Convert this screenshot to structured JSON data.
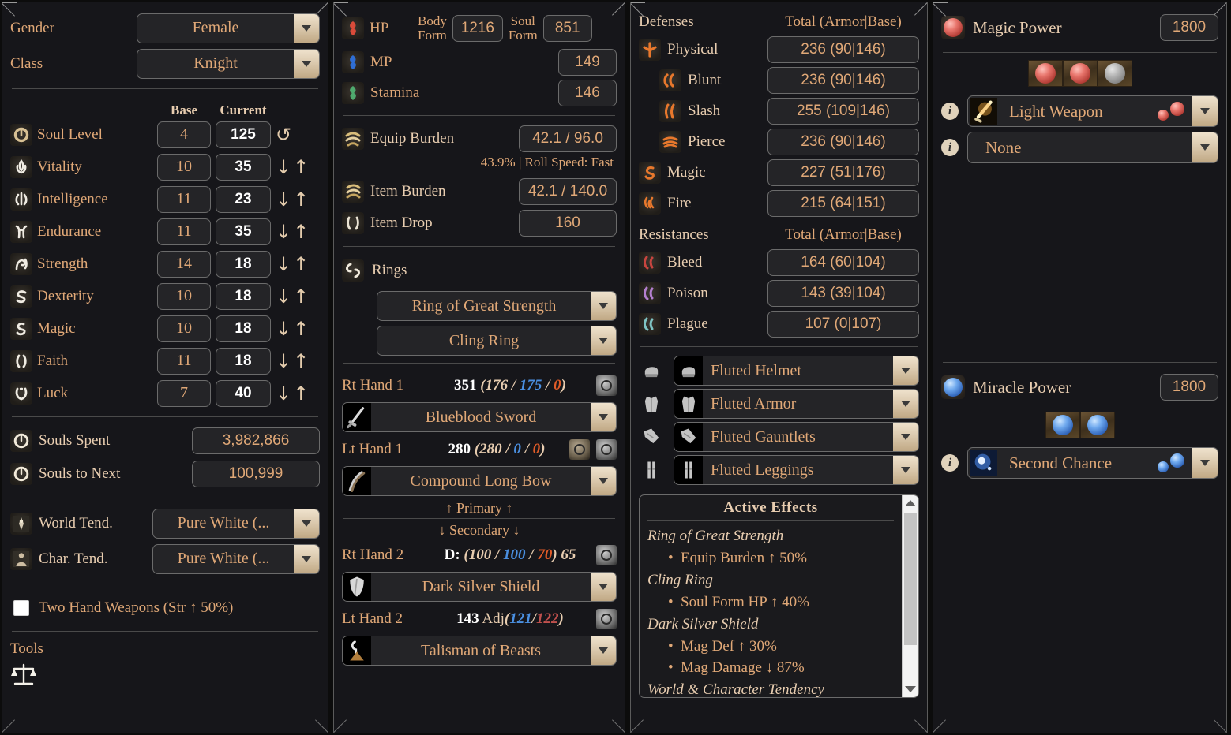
{
  "panel1": {
    "gender": {
      "label": "Gender",
      "value": "Female"
    },
    "class": {
      "label": "Class",
      "value": "Knight"
    },
    "columns": {
      "base": "Base",
      "current": "Current"
    },
    "stats": [
      {
        "icon": "soul-level-icon",
        "label": "Soul Level",
        "base": "4",
        "current": "125",
        "control": "reset"
      },
      {
        "icon": "vitality-icon",
        "label": "Vitality",
        "base": "10",
        "current": "35",
        "control": "updown"
      },
      {
        "icon": "intelligence-icon",
        "label": "Intelligence",
        "base": "11",
        "current": "23",
        "control": "updown"
      },
      {
        "icon": "endurance-icon",
        "label": "Endurance",
        "base": "11",
        "current": "35",
        "control": "updown"
      },
      {
        "icon": "strength-icon",
        "label": "Strength",
        "base": "14",
        "current": "18",
        "control": "updown"
      },
      {
        "icon": "dexterity-icon",
        "label": "Dexterity",
        "base": "10",
        "current": "18",
        "control": "updown"
      },
      {
        "icon": "magic-icon",
        "label": "Magic",
        "base": "10",
        "current": "18",
        "control": "updown"
      },
      {
        "icon": "faith-icon",
        "label": "Faith",
        "base": "11",
        "current": "18",
        "control": "updown"
      },
      {
        "icon": "luck-icon",
        "label": "Luck",
        "base": "7",
        "current": "40",
        "control": "updown"
      }
    ],
    "souls_spent": {
      "label": "Souls Spent",
      "value": "3,982,866"
    },
    "souls_next": {
      "label": "Souls to Next",
      "value": "100,999"
    },
    "world_tend": {
      "label": "World Tend.",
      "value": "Pure White (..."
    },
    "char_tend": {
      "label": "Char. Tend.",
      "value": "Pure White (..."
    },
    "two_hand": {
      "label": "Two Hand Weapons (Str ↑ 50%)",
      "checked": false
    },
    "tools": {
      "label": "Tools",
      "items": [
        "scales-icon"
      ]
    }
  },
  "panel2": {
    "hp": {
      "label": "HP",
      "body_form_label": "Body\nForm",
      "body_form": "1216",
      "soul_form_label": "Soul\nForm",
      "soul_form": "851"
    },
    "mp": {
      "label": "MP",
      "value": "149"
    },
    "stamina": {
      "label": "Stamina",
      "value": "146"
    },
    "equip_burden": {
      "label": "Equip Burden",
      "value": "42.1 / 96.0"
    },
    "burden_note": "43.9% | Roll Speed: Fast",
    "item_burden": {
      "label": "Item Burden",
      "value": "42.1 / 140.0"
    },
    "item_drop": {
      "label": "Item Drop",
      "value": "160"
    },
    "rings_label": "Rings",
    "rings": [
      "Ring of Great Strength",
      "Cling Ring"
    ],
    "hands": [
      {
        "slot": "Rt Hand 1",
        "total": "351",
        "phys": "176",
        "magic": "175",
        "fire": "0",
        "prefix": "",
        "suffix": "",
        "weapon": "Blueblood Sword",
        "icon": "sword-icon",
        "has_wt": false
      },
      {
        "slot": "Lt Hand 1",
        "total": "280",
        "phys": "280",
        "magic": "0",
        "fire": "0",
        "prefix": "",
        "suffix": "",
        "weapon": "Compound Long Bow",
        "icon": "bow-icon",
        "has_wt": true
      }
    ],
    "primary_label": "↑ Primary ↑",
    "secondary_label": "↓ Secondary ↓",
    "hands2": [
      {
        "slot": "Rt Hand 2",
        "prefix": "D:",
        "phys": "100",
        "magic": "100",
        "fire": "70",
        "suffix": "65",
        "weapon": "Dark Silver Shield",
        "icon": "shield-icon",
        "has_wt": false
      },
      {
        "slot": "Lt Hand 2",
        "total": "143",
        "adj_label": "Adj",
        "magic": "121",
        "bleed": "122",
        "weapon": "Talisman of Beasts",
        "icon": "talisman-icon",
        "has_wt": false
      }
    ]
  },
  "panel3": {
    "defenses_label": "Defenses",
    "defenses_col": "Total (Armor|Base)",
    "defenses": [
      {
        "icon": "physical-icon",
        "label": "Physical",
        "value": "236 (90|146)",
        "indent": false
      },
      {
        "icon": "blunt-icon",
        "label": "Blunt",
        "value": "236 (90|146)",
        "indent": true
      },
      {
        "icon": "slash-icon",
        "label": "Slash",
        "value": "255 (109|146)",
        "indent": true
      },
      {
        "icon": "pierce-icon",
        "label": "Pierce",
        "value": "236 (90|146)",
        "indent": true
      },
      {
        "icon": "magic-def-icon",
        "label": "Magic",
        "value": "227 (51|176)",
        "indent": false
      },
      {
        "icon": "fire-icon",
        "label": "Fire",
        "value": "215 (64|151)",
        "indent": false
      }
    ],
    "resistances_label": "Resistances",
    "resistances_col": "Total (Armor|Base)",
    "resistances": [
      {
        "icon": "bleed-icon",
        "label": "Bleed",
        "value": "164 (60|104)"
      },
      {
        "icon": "poison-icon",
        "label": "Poison",
        "value": "143 (39|104)"
      },
      {
        "icon": "plague-icon",
        "label": "Plague",
        "value": "107 (0|107)"
      }
    ],
    "armor": [
      {
        "slot": "helmet-slot",
        "name": "Fluted Helmet"
      },
      {
        "slot": "chest-slot",
        "name": "Fluted Armor"
      },
      {
        "slot": "gauntlets-slot",
        "name": "Fluted Gauntlets"
      },
      {
        "slot": "leggings-slot",
        "name": "Fluted Leggings"
      }
    ],
    "effects": {
      "title": "Active Effects",
      "groups": [
        {
          "source": "Ring of Great Strength",
          "items": [
            "Equip Burden ↑ 50%"
          ]
        },
        {
          "source": "Cling Ring",
          "items": [
            "Soul Form HP ↑ 40%"
          ]
        },
        {
          "source": "Dark Silver Shield",
          "items": [
            "Mag Def ↑ 30%",
            "Mag Damage ↓ 87%"
          ]
        },
        {
          "source": "World & Character Tendency",
          "items": []
        }
      ]
    }
  },
  "panel4": {
    "magic": {
      "label": "Magic Power",
      "value": "1800",
      "slots": [
        "filled",
        "filled",
        "empty"
      ],
      "spells": [
        {
          "name": "Light Weapon",
          "icon": "light-weapon-icon",
          "cost_orbs": 2,
          "color": "red"
        },
        {
          "name": "None",
          "icon": "",
          "cost_orbs": 0,
          "color": "red"
        }
      ]
    },
    "miracle": {
      "label": "Miracle Power",
      "value": "1800",
      "slots": [
        "filled",
        "filled"
      ],
      "spells": [
        {
          "name": "Second Chance",
          "icon": "second-chance-icon",
          "cost_orbs": 2,
          "color": "blue"
        }
      ]
    }
  },
  "colors": {
    "accent": "#e0a877",
    "light_text": "#e8cdb0",
    "panel_bg": "#16161a",
    "box_bg": "#242427",
    "border": "#6b6b6b",
    "magic_blue": "#4a8fe0",
    "fire_orange": "#e05b28",
    "defense_orange": "#e8782c"
  }
}
